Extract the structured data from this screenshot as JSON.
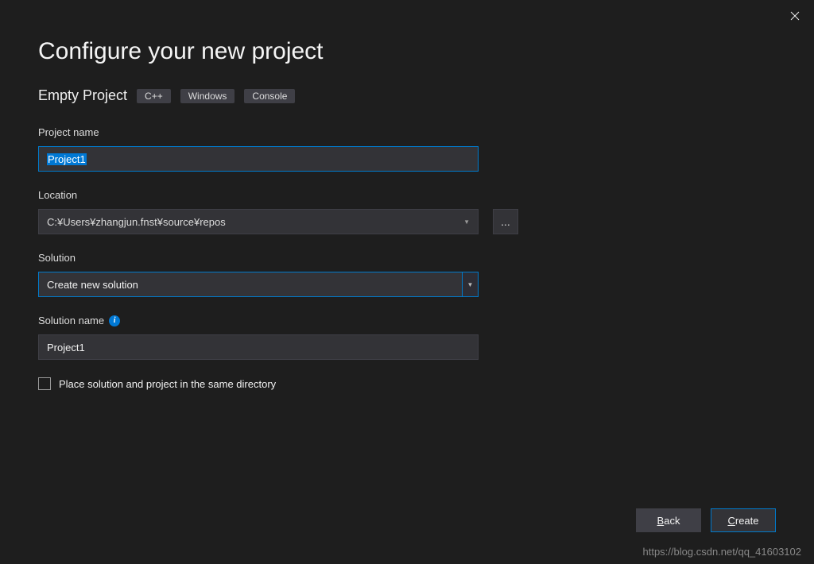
{
  "heading": "Configure your new project",
  "template": {
    "name": "Empty Project",
    "tags": [
      "C++",
      "Windows",
      "Console"
    ]
  },
  "labels": {
    "project_name": "Project name",
    "location": "Location",
    "solution": "Solution",
    "solution_name": "Solution name"
  },
  "values": {
    "project_name": "Project1",
    "location": "C:¥Users¥zhangjun.fnst¥source¥repos",
    "solution": "Create new solution",
    "solution_name": "Project1"
  },
  "browse_button": "...",
  "checkbox": {
    "label": "Place solution and project in the same directory",
    "checked": false
  },
  "buttons": {
    "back": "Back",
    "create": "Create"
  },
  "watermark": "https://blog.csdn.net/qq_41603102"
}
